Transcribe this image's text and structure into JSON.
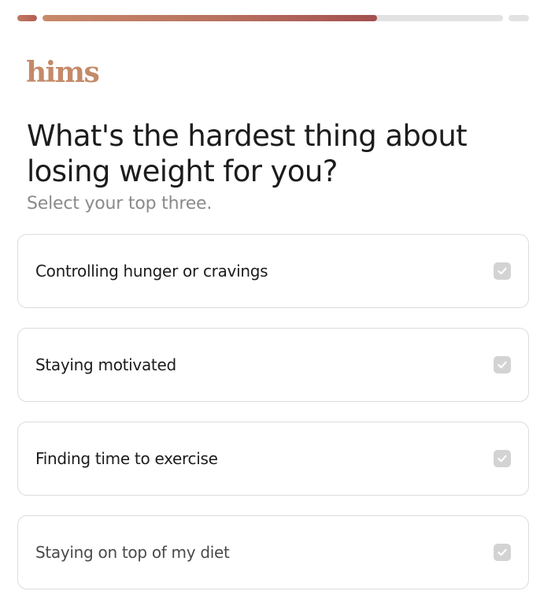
{
  "progress": {
    "segments": [
      {
        "name": "step-1",
        "fill": 1.0
      },
      {
        "name": "step-2",
        "fill": 0.727
      },
      {
        "name": "step-3",
        "fill": 0.0
      }
    ]
  },
  "brand": {
    "logo_text": "hims",
    "color": "#c48a68"
  },
  "question": {
    "title": "What's the hardest thing about losing weight for you?",
    "subtitle": "Select your top three."
  },
  "options": [
    {
      "label": "Controlling hunger or cravings",
      "checked": false,
      "icon": "checkbox-check-icon"
    },
    {
      "label": "Staying motivated",
      "checked": false,
      "icon": "checkbox-check-icon"
    },
    {
      "label": "Finding time to exercise",
      "checked": false,
      "icon": "checkbox-check-icon"
    },
    {
      "label": "Staying on top of my diet",
      "checked": false,
      "icon": "checkbox-check-icon"
    }
  ],
  "colors": {
    "accent_gradient_start": "#c88a6a",
    "accent_gradient_end": "#a3504f",
    "track": "#e2e2e2",
    "checkbox_unchecked": "#d3d3d3"
  }
}
